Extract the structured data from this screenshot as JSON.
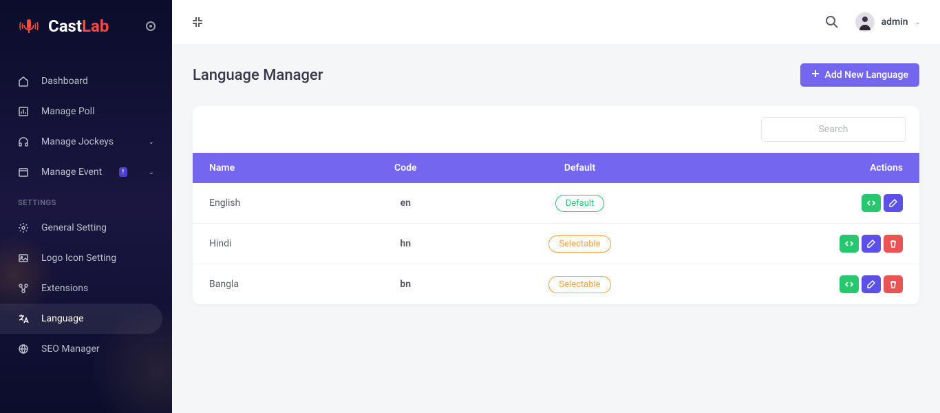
{
  "brand": {
    "name_part1": "Cast",
    "name_part2": "Lab"
  },
  "header": {
    "username": "admin"
  },
  "sidebar": {
    "items": [
      {
        "label": "Dashboard",
        "icon": "home"
      },
      {
        "label": "Manage Poll",
        "icon": "poll"
      },
      {
        "label": "Manage Jockeys",
        "icon": "headphones",
        "expandable": true
      },
      {
        "label": "Manage Event",
        "icon": "calendar",
        "badge": "!",
        "expandable": true
      }
    ],
    "section_label": "SETTINGS",
    "settings_items": [
      {
        "label": "General Setting",
        "icon": "gear"
      },
      {
        "label": "Logo Icon Setting",
        "icon": "image"
      },
      {
        "label": "Extensions",
        "icon": "nodes"
      },
      {
        "label": "Language",
        "icon": "translate",
        "active": true
      },
      {
        "label": "SEO Manager",
        "icon": "globe"
      }
    ]
  },
  "page": {
    "title": "Language Manager",
    "add_button": "Add New Language",
    "search_placeholder": "Search"
  },
  "table": {
    "headers": {
      "name": "Name",
      "code": "Code",
      "default": "Default",
      "actions": "Actions"
    },
    "status_labels": {
      "default": "Default",
      "selectable": "Selectable"
    },
    "rows": [
      {
        "name": "English",
        "code": "en",
        "status": "default",
        "deletable": false
      },
      {
        "name": "Hindi",
        "code": "hn",
        "status": "selectable",
        "deletable": true
      },
      {
        "name": "Bangla",
        "code": "bn",
        "status": "selectable",
        "deletable": true
      }
    ]
  }
}
